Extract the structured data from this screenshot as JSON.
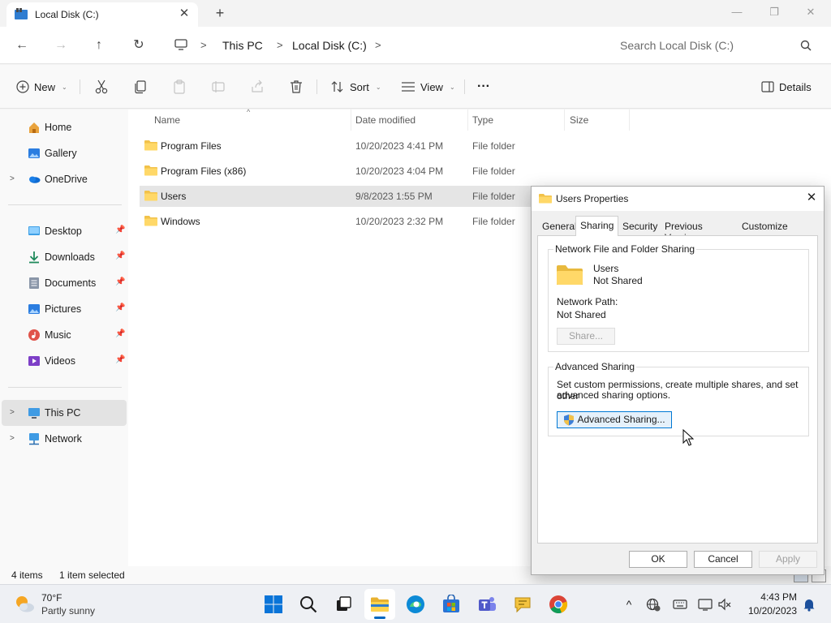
{
  "window": {
    "tab_title": "Local Disk (C:)",
    "tab_close": "✕",
    "new_tab": "+",
    "controls": {
      "minimize": "—",
      "maximize": "❐",
      "close": "✕"
    }
  },
  "address": {
    "back": "←",
    "forward": "→",
    "up": "↑",
    "refresh": "↻",
    "breadcrumb": [
      "This PC",
      "Local Disk (C:)"
    ],
    "separator": ">",
    "search_placeholder": "Search Local Disk (C:)"
  },
  "commands": {
    "new": "New",
    "sort": "Sort",
    "view": "View",
    "more": "···",
    "details": "Details",
    "caret": "⌄"
  },
  "nav": {
    "items": [
      {
        "label": "Home",
        "icon": "home-icon"
      },
      {
        "label": "Gallery",
        "icon": "gallery-icon"
      },
      {
        "label": "OneDrive",
        "icon": "onedrive-icon",
        "expandable": true
      },
      {
        "label": "Desktop",
        "icon": "desktop-icon",
        "pinned": true
      },
      {
        "label": "Downloads",
        "icon": "downloads-icon",
        "pinned": true
      },
      {
        "label": "Documents",
        "icon": "documents-icon",
        "pinned": true
      },
      {
        "label": "Pictures",
        "icon": "pictures-icon",
        "pinned": true
      },
      {
        "label": "Music",
        "icon": "music-icon",
        "pinned": true
      },
      {
        "label": "Videos",
        "icon": "videos-icon",
        "pinned": true
      },
      {
        "label": "This PC",
        "icon": "this-pc-icon",
        "expandable": true,
        "selected": true
      },
      {
        "label": "Network",
        "icon": "network-icon",
        "expandable": true
      }
    ],
    "expand_glyph": ">",
    "pin_glyph": "📌"
  },
  "files": {
    "columns": [
      "Name",
      "Date modified",
      "Type",
      "Size"
    ],
    "sort_glyph": "^",
    "rows": [
      {
        "name": "Program Files",
        "date": "10/20/2023 4:41 PM",
        "type": "File folder"
      },
      {
        "name": "Program Files (x86)",
        "date": "10/20/2023 4:04 PM",
        "type": "File folder"
      },
      {
        "name": "Users",
        "date": "9/8/2023 1:55 PM",
        "type": "File folder",
        "selected": true
      },
      {
        "name": "Windows",
        "date": "10/20/2023 2:32 PM",
        "type": "File folder"
      }
    ]
  },
  "status": {
    "items": "4 items",
    "selected": "1 item selected"
  },
  "dialog": {
    "title": "Users Properties",
    "close": "✕",
    "tabs": [
      "General",
      "Sharing",
      "Security",
      "Previous Versions",
      "Customize"
    ],
    "active_tab": "Sharing",
    "network_group": {
      "label": "Network File and Folder Sharing",
      "folder_name": "Users",
      "share_state": "Not Shared",
      "path_label": "Network Path:",
      "path_value": "Not Shared",
      "share_button": "Share..."
    },
    "advanced_group": {
      "label": "Advanced Sharing",
      "description_line1": "Set custom permissions, create multiple shares, and set other",
      "description_line2": "advanced sharing options.",
      "button": "Advanced Sharing..."
    },
    "buttons": {
      "ok": "OK",
      "cancel": "Cancel",
      "apply": "Apply"
    }
  },
  "taskbar": {
    "weather_temp": "70°F",
    "weather_desc": "Partly sunny",
    "clock_time": "4:43 PM",
    "clock_date": "10/20/2023",
    "tray_chevron": "^",
    "accent": "#0067c0"
  }
}
